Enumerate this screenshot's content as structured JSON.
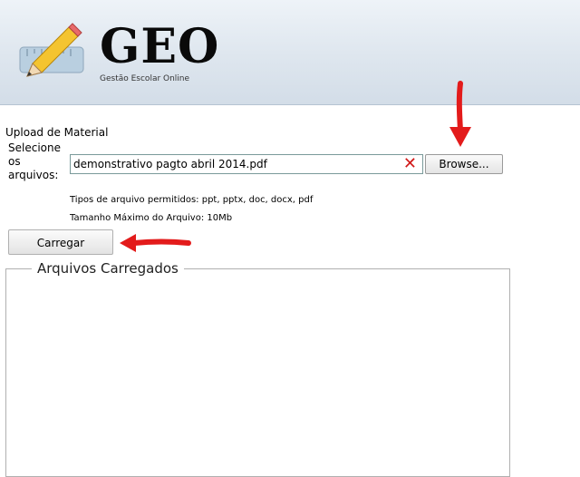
{
  "header": {
    "title": "GEO",
    "subtitle": "Gestão Escolar Online"
  },
  "upload": {
    "section_title": "Upload de Material",
    "select_label": "Selecione os arquivos:",
    "file_value": "demonstrativo pagto abril 2014.pdf",
    "clear_icon": "close-icon",
    "browse_label": "Browse...",
    "allowed_types": "Tipos de arquivo permitidos: ppt, pptx, doc, docx, pdf",
    "max_size": "Tamanho Máximo do Arquivo: 10Mb",
    "upload_label": "Carregar"
  },
  "files_panel": {
    "legend": "Arquivos Carregados"
  },
  "colors": {
    "annotation_arrow": "#e31b1b",
    "header_bg": "#dfe7ef",
    "clear_icon": "#d11919"
  }
}
